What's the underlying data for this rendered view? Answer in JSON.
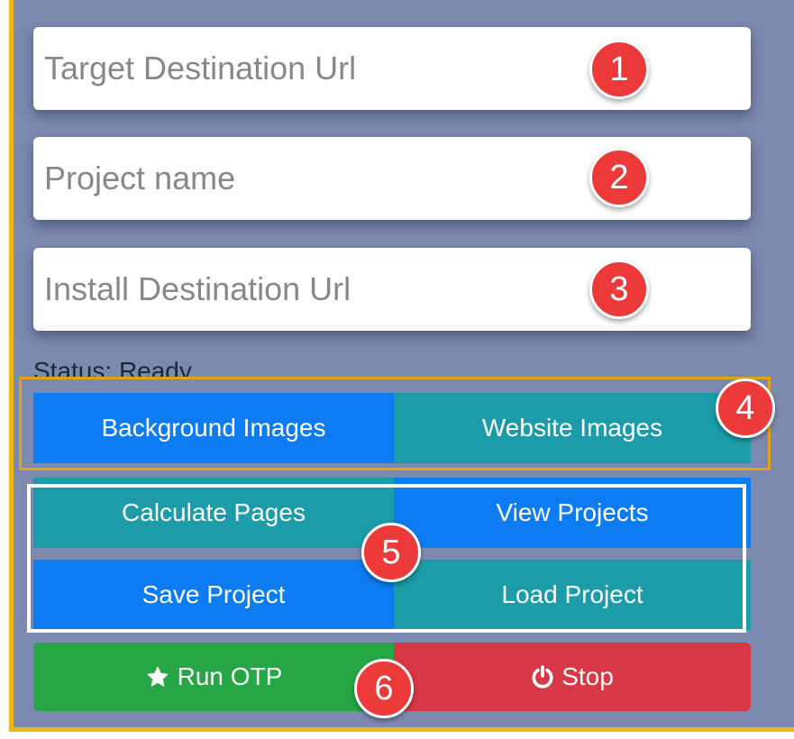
{
  "fields": [
    {
      "placeholder": "Target Destination Url",
      "value": "",
      "badge": "1"
    },
    {
      "placeholder": "Project name",
      "value": "",
      "badge": "2"
    },
    {
      "placeholder": "Install Destination Url",
      "value": "",
      "badge": "3"
    }
  ],
  "status_text": "Status: Ready.",
  "group4": {
    "badge": "4",
    "background_images": "Background Images",
    "website_images": "Website Images"
  },
  "group5": {
    "badge": "5",
    "calculate_pages": "Calculate Pages",
    "view_projects": "View Projects",
    "save_project": "Save Project",
    "load_project": "Load Project"
  },
  "group6": {
    "badge": "6",
    "run_label": "Run OTP",
    "stop_label": "Stop",
    "run_icon": "star-icon",
    "stop_icon": "power-icon"
  },
  "colors": {
    "panel": "#7d8ab0",
    "frame_yellow": "#e9b913",
    "badge_red": "#ec3a3a",
    "blue": "#0d7cf3",
    "teal": "#1b9ca8",
    "green": "#27a645",
    "red": "#d83745"
  }
}
